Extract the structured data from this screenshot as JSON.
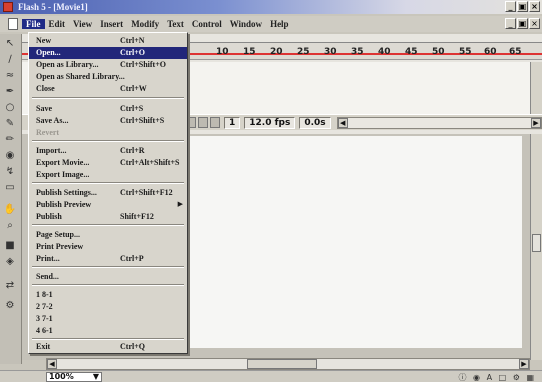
{
  "window": {
    "title": "Flash 5 - [Movie1]"
  },
  "menubar": {
    "items": [
      "File",
      "Edit",
      "View",
      "Insert",
      "Modify",
      "Text",
      "Control",
      "Window",
      "Help"
    ]
  },
  "timeline": {
    "frame_numbers": [
      "10",
      "15",
      "20",
      "25",
      "30",
      "35",
      "40",
      "45",
      "50",
      "55",
      "60",
      "65"
    ],
    "current_frame": "1",
    "frame_rate": "12.0 fps",
    "elapsed": "0.0s"
  },
  "file_menu": {
    "items": [
      {
        "label": "New",
        "shortcut": "Ctrl+N"
      },
      {
        "label": "Open...",
        "shortcut": "Ctrl+O"
      },
      {
        "label": "Open as Library...",
        "shortcut": "Ctrl+Shift+O"
      },
      {
        "label": "Open as Shared Library...",
        "shortcut": ""
      },
      {
        "label": "Close",
        "shortcut": "Ctrl+W"
      },
      {
        "label": "Save",
        "shortcut": "Ctrl+S"
      },
      {
        "label": "Save As...",
        "shortcut": "Ctrl+Shift+S"
      },
      {
        "label": "Revert",
        "shortcut": ""
      },
      {
        "label": "Import...",
        "shortcut": "Ctrl+R"
      },
      {
        "label": "Export Movie...",
        "shortcut": "Ctrl+Alt+Shift+S"
      },
      {
        "label": "Export Image...",
        "shortcut": ""
      },
      {
        "label": "Publish Settings...",
        "shortcut": "Ctrl+Shift+F12"
      },
      {
        "label": "Publish Preview",
        "shortcut": ""
      },
      {
        "label": "Publish",
        "shortcut": "Shift+F12"
      },
      {
        "label": "Page Setup...",
        "shortcut": ""
      },
      {
        "label": "Print Preview",
        "shortcut": ""
      },
      {
        "label": "Print...",
        "shortcut": "Ctrl+P"
      },
      {
        "label": "Send...",
        "shortcut": ""
      },
      {
        "label": "1 8-1",
        "shortcut": ""
      },
      {
        "label": "2 7-2",
        "shortcut": ""
      },
      {
        "label": "3 7-1",
        "shortcut": ""
      },
      {
        "label": "4 6-1",
        "shortcut": ""
      },
      {
        "label": "Exit",
        "shortcut": "Ctrl+Q"
      }
    ]
  },
  "status": {
    "zoom": "100%"
  },
  "colors": {
    "title_start": "#4a5fb0",
    "highlight": "#22277a",
    "timeline_playhead": "#dd3333"
  }
}
